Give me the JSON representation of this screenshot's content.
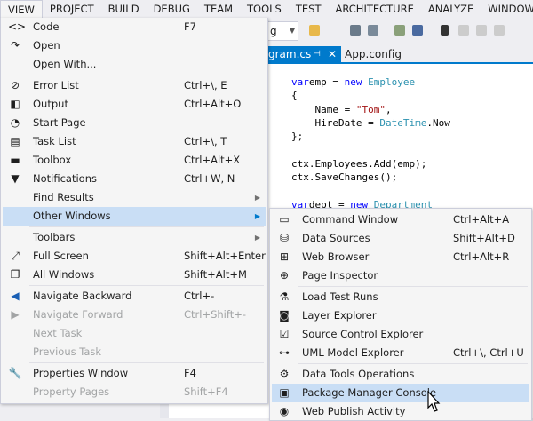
{
  "menubar": [
    "VIEW",
    "PROJECT",
    "BUILD",
    "DEBUG",
    "TEAM",
    "TOOLS",
    "TEST",
    "ARCHITECTURE",
    "ANALYZE",
    "WINDOW"
  ],
  "toolbar": {
    "config_value": "g"
  },
  "tabs": [
    {
      "label": "gram.cs",
      "pin": "⊣",
      "close": "✕"
    },
    {
      "label": "App.config"
    }
  ],
  "code": [
    [
      [
        "kw",
        "var"
      ],
      [
        "",
        "emp = "
      ],
      [
        "kw",
        "new"
      ],
      [
        "",
        ""
      ],
      [
        "ty",
        " Employee"
      ]
    ],
    [
      [
        "",
        "{"
      ]
    ],
    [
      [
        "",
        "    Name = "
      ],
      [
        "st",
        "\"Tom\""
      ],
      [
        "",
        ","
      ]
    ],
    [
      [
        "",
        "    HireDate = "
      ],
      [
        "ty",
        "DateTime"
      ],
      [
        "",
        ".Now"
      ]
    ],
    [
      [
        "",
        "};"
      ]
    ],
    [],
    [
      [
        "",
        "ctx.Employees.Add(emp);"
      ]
    ],
    [
      [
        "",
        "ctx.SaveChanges();"
      ]
    ],
    [],
    [
      [
        "kw",
        "var"
      ],
      [
        "",
        "dept = "
      ],
      [
        "kw",
        "new"
      ],
      [
        "ty",
        " Department"
      ]
    ]
  ],
  "view_menu": [
    {
      "label": "Code",
      "shortcut": "F7",
      "icon": "code-icon",
      "glyph": "<>"
    },
    {
      "label": "Open",
      "icon": "open-icon",
      "glyph": "↷"
    },
    {
      "label": "Open With...",
      "sep_after": true
    },
    {
      "label": "Error List",
      "shortcut": "Ctrl+\\, E",
      "icon": "error-list-icon",
      "glyph": "⊘"
    },
    {
      "label": "Output",
      "shortcut": "Ctrl+Alt+O",
      "icon": "output-icon",
      "glyph": "◧"
    },
    {
      "label": "Start Page",
      "icon": "start-page-icon",
      "glyph": "◔"
    },
    {
      "label": "Task List",
      "shortcut": "Ctrl+\\, T",
      "icon": "task-list-icon",
      "glyph": "▤"
    },
    {
      "label": "Toolbox",
      "shortcut": "Ctrl+Alt+X",
      "icon": "toolbox-icon",
      "glyph": "▬"
    },
    {
      "label": "Notifications",
      "shortcut": "Ctrl+W, N",
      "icon": "notifications-icon",
      "glyph": "▼"
    },
    {
      "label": "Find Results",
      "submenu": true
    },
    {
      "label": "Other Windows",
      "submenu": true,
      "highlighted": true,
      "sep_after": true
    },
    {
      "label": "Toolbars",
      "submenu": true
    },
    {
      "label": "Full Screen",
      "shortcut": "Shift+Alt+Enter",
      "icon": "full-screen-icon",
      "glyph": "⤢"
    },
    {
      "label": "All Windows",
      "shortcut": "Shift+Alt+M",
      "icon": "all-windows-icon",
      "glyph": "❐",
      "sep_after": true
    },
    {
      "label": "Navigate Backward",
      "shortcut": "Ctrl+-",
      "icon": "navigate-backward-icon",
      "glyph": "◀",
      "color": "#1a5fb4"
    },
    {
      "label": "Navigate Forward",
      "shortcut": "Ctrl+Shift+-",
      "icon": "navigate-forward-icon",
      "glyph": "▶",
      "disabled": true
    },
    {
      "label": "Next Task",
      "disabled": true
    },
    {
      "label": "Previous Task",
      "disabled": true,
      "sep_after": true
    },
    {
      "label": "Properties Window",
      "shortcut": "F4",
      "icon": "wrench-icon",
      "glyph": "🔧"
    },
    {
      "label": "Property Pages",
      "shortcut": "Shift+F4",
      "disabled": true
    }
  ],
  "other_windows_menu": [
    {
      "label": "Command Window",
      "shortcut": "Ctrl+Alt+A",
      "icon": "command-window-icon",
      "glyph": "▭"
    },
    {
      "label": "Data Sources",
      "shortcut": "Shift+Alt+D",
      "icon": "data-sources-icon",
      "glyph": "⛁"
    },
    {
      "label": "Web Browser",
      "shortcut": "Ctrl+Alt+R",
      "icon": "web-browser-icon",
      "glyph": "⊞"
    },
    {
      "label": "Page Inspector",
      "icon": "page-inspector-icon",
      "glyph": "⊕",
      "sep_after": true
    },
    {
      "label": "Load Test Runs",
      "icon": "load-test-icon",
      "glyph": "⚗"
    },
    {
      "label": "Layer Explorer",
      "icon": "layer-explorer-icon",
      "glyph": "◙"
    },
    {
      "label": "Source Control Explorer",
      "icon": "source-control-icon",
      "glyph": "☑"
    },
    {
      "label": "UML Model Explorer",
      "shortcut": "Ctrl+\\, Ctrl+U",
      "icon": "uml-explorer-icon",
      "glyph": "⊶",
      "sep_after": true
    },
    {
      "label": "Data Tools Operations",
      "icon": "data-tools-icon",
      "glyph": "⚙"
    },
    {
      "label": "Package Manager Console",
      "icon": "package-console-icon",
      "glyph": "▣",
      "highlighted": true
    },
    {
      "label": "Web Publish Activity",
      "icon": "web-publish-icon",
      "glyph": "◉"
    }
  ],
  "colors": {
    "accent": "#007acc",
    "highlight": "#c9def5"
  }
}
